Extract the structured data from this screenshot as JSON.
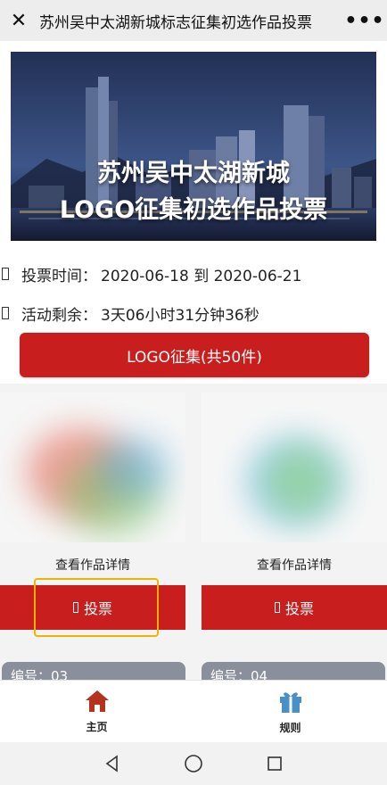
{
  "header": {
    "close_icon": "close-icon",
    "title": "苏州吴中太湖新城标志征集初选作品投票",
    "more_icon": "more-icon"
  },
  "banner": {
    "line1": "苏州吴中太湖新城",
    "line2": "LOGO征集初选作品投票"
  },
  "info": {
    "vote_time_label": "投票时间：",
    "vote_time_value": "2020-06-18 到 2020-06-21",
    "remaining_label": "活动剩余：",
    "remaining_value": "3天06小时31分钟36秒"
  },
  "main_button": "LOGO征集(共50件)",
  "cards": [
    {
      "detail_label": "查看作品详情",
      "vote_label": "投票",
      "number_label": "编号：03"
    },
    {
      "detail_label": "查看作品详情",
      "vote_label": "投票",
      "number_label": "编号：04"
    }
  ],
  "tabs": [
    {
      "label": "主页",
      "icon": "home-icon"
    },
    {
      "label": "规则",
      "icon": "gift-icon"
    }
  ],
  "colors": {
    "accent_red": "#c81e1e",
    "highlight": "#f0b400",
    "tab_icon_red": "#b5321e",
    "tab_icon_blue": "#4a90c8"
  }
}
